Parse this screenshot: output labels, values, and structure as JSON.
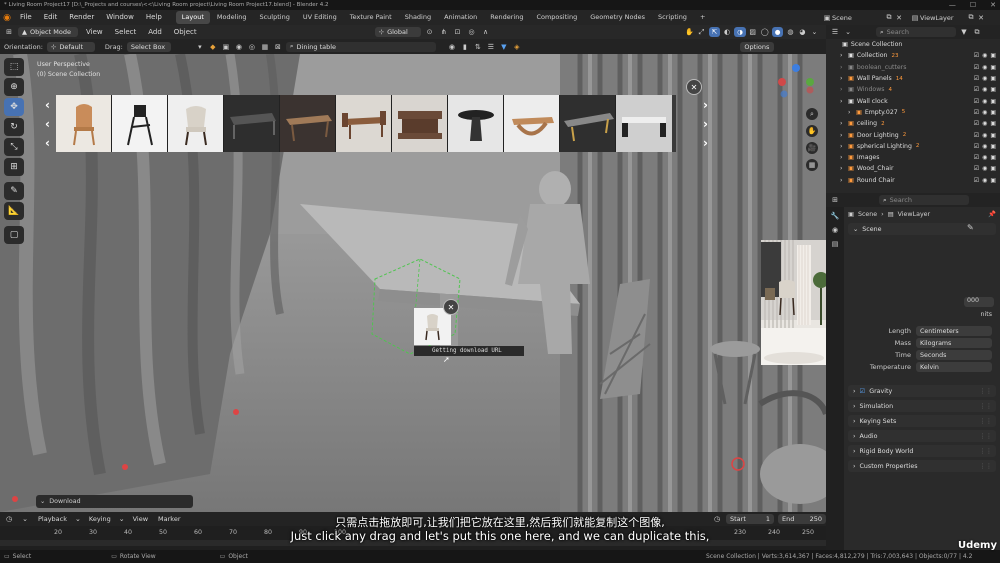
{
  "window": {
    "title": "* Living Room Project17 [D:\\_Projects and courses\\<<\\Living Room project\\Living Room Project17.blend] - Blender 4.2",
    "minimize": "—",
    "maximize": "☐",
    "close": "✕"
  },
  "menu": {
    "items": [
      "File",
      "Edit",
      "Render",
      "Window",
      "Help"
    ],
    "workspaces": [
      "Layout",
      "Modeling",
      "Sculpting",
      "UV Editing",
      "Texture Paint",
      "Shading",
      "Animation",
      "Rendering",
      "Compositing",
      "Geometry Nodes",
      "Scripting"
    ],
    "active_workspace": "Layout",
    "add_workspace": "+",
    "scene": "Scene",
    "view_layer": "ViewLayer"
  },
  "header": {
    "mode": "Object Mode",
    "menus": [
      "View",
      "Select",
      "Add",
      "Object"
    ],
    "transform_orientation": "Global",
    "orientation_label": "Orientation:",
    "orientation_value": "Default",
    "drag_label": "Drag:",
    "drag_value": "Select Box",
    "asset_search": "Dining table",
    "options": "Options"
  },
  "viewport": {
    "perspective": "User Perspective",
    "collection": "(0) Scene Collection",
    "drag_tooltip": "Getting download URL",
    "download_panel": "Download"
  },
  "asset_strip": {
    "thumb_count": 11,
    "colors": [
      "#e8e4de",
      "#f2f2f2",
      "#eeeeee",
      "#2c2c2c",
      "#3a3330",
      "#d9d5d0",
      "#d8d4d0",
      "#e5e5e5",
      "#ececec",
      "#303030",
      "#d0d0d0"
    ]
  },
  "outliner": {
    "search_placeholder": "Search",
    "root": "Scene Collection",
    "items": [
      {
        "label": "Collection",
        "badge": "23"
      },
      {
        "label": "boolean_cutters",
        "badge": ""
      },
      {
        "label": "Wall Panels",
        "badge": "14"
      },
      {
        "label": "Windows",
        "badge": "4"
      },
      {
        "label": "Wall clock",
        "badge": ""
      },
      {
        "label": "Empty.027",
        "badge": "5"
      },
      {
        "label": "ceiling",
        "badge": "2"
      },
      {
        "label": "Door Lighting",
        "badge": "2"
      },
      {
        "label": "spherical Lighting",
        "badge": "2"
      },
      {
        "label": "Images",
        "badge": ""
      },
      {
        "label": "Wood_Chair",
        "badge": ""
      },
      {
        "label": "Round Chair",
        "badge": ""
      }
    ]
  },
  "properties": {
    "search_placeholder": "Search",
    "breadcrumb_scene": "Scene",
    "breadcrumb_viewlayer": "ViewLayer",
    "section_scene": "Scene",
    "partial_value": "000",
    "partial_units": "nits",
    "units": [
      {
        "label": "Length",
        "value": "Centimeters"
      },
      {
        "label": "Mass",
        "value": "Kilograms"
      },
      {
        "label": "Time",
        "value": "Seconds"
      },
      {
        "label": "Temperature",
        "value": "Kelvin"
      }
    ],
    "panels": [
      "Gravity",
      "Simulation",
      "Keying Sets",
      "Audio",
      "Rigid Body World",
      "Custom Properties"
    ]
  },
  "timeline": {
    "menus": [
      "Playback",
      "Keying",
      "View",
      "Marker"
    ],
    "start_label": "Start",
    "start": "1",
    "end_label": "End",
    "end": "250",
    "ticks": [
      "20",
      "30",
      "40",
      "50",
      "60",
      "70",
      "80",
      "90",
      "100",
      "230",
      "240",
      "250"
    ]
  },
  "statusbar": {
    "select": "Select",
    "rotate": "Rotate View",
    "object": "Object",
    "stats": "Scene Collection | Verts:3,614,367 | Faces:4,812,279 | Tris:7,003,643 | Objects:0/77 | 4.2",
    "watermark": "Udemy"
  },
  "subtitles": {
    "zh": "只需点击拖放即可,让我们把它放在这里,然后我们就能复制这个图像,",
    "en": "Just click any drag and let's put this one here, and we can duplicate this,"
  }
}
